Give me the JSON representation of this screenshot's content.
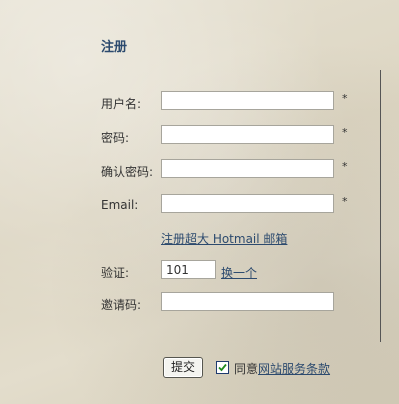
{
  "form": {
    "title": "注册",
    "required_mark": "*",
    "fields": {
      "username": {
        "label": "用户名:",
        "value": ""
      },
      "password": {
        "label": "密码:",
        "value": ""
      },
      "confirm_password": {
        "label": "确认密码:",
        "value": ""
      },
      "email": {
        "label": "Email:",
        "value": ""
      },
      "captcha": {
        "label": "验证:",
        "value": "101"
      },
      "invite_code": {
        "label": "邀请码:",
        "value": ""
      }
    },
    "hotmail_link": "注册超大 Hotmail 邮箱",
    "captcha_refresh_link": "换一个",
    "submit_label": "提交",
    "agree_prefix": "同意",
    "terms_link": "网站服务条款",
    "agree_checked": true
  }
}
